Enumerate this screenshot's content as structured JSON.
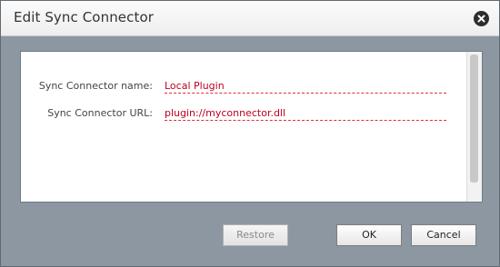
{
  "dialog": {
    "title": "Edit Sync Connector",
    "close_icon": "close-icon"
  },
  "form": {
    "name_label": "Sync Connector name:",
    "name_value": "Local Plugin",
    "url_label": "Sync Connector URL:",
    "url_value": "plugin://myconnector.dll"
  },
  "buttons": {
    "restore": "Restore",
    "ok": "OK",
    "cancel": "Cancel"
  }
}
